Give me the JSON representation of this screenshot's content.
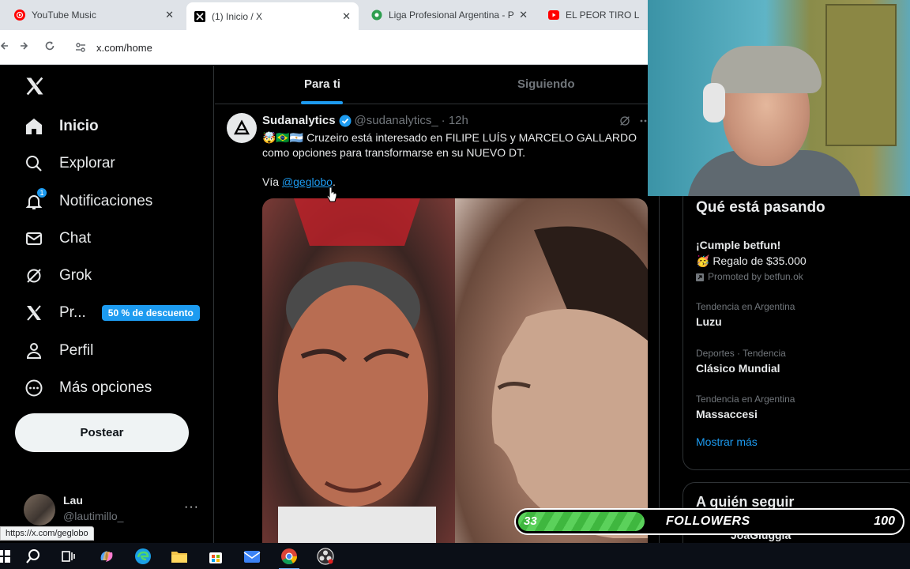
{
  "browser": {
    "tabs": [
      {
        "label": "YouTube Music",
        "icon": "youtube-music-icon",
        "active": false
      },
      {
        "label": "(1) Inicio / X",
        "icon": "x-logo-icon",
        "active": true
      },
      {
        "label": "Liga Profesional Argentina - PO",
        "icon": "ball-icon",
        "active": false
      },
      {
        "label": "EL PEOR TIRO LIBRE D",
        "icon": "youtube-icon",
        "active": false
      }
    ],
    "url": "x.com/home",
    "status_url": "https://x.com/geglobo"
  },
  "sidebar": {
    "items": [
      {
        "label": "Inicio",
        "icon": "home-icon"
      },
      {
        "label": "Explorar",
        "icon": "search-icon"
      },
      {
        "label": "Notificaciones",
        "icon": "bell-icon",
        "badge": "1"
      },
      {
        "label": "Chat",
        "icon": "mail-icon"
      },
      {
        "label": "Grok",
        "icon": "grok-icon"
      },
      {
        "label": "Pr...",
        "icon": "x-premium-icon",
        "promo": "50 % de descuento"
      },
      {
        "label": "Perfil",
        "icon": "person-icon"
      },
      {
        "label": "Más opciones",
        "icon": "more-circle-icon"
      }
    ],
    "post_button": "Postear",
    "account": {
      "name": "Lau",
      "handle": "@lautimillo_",
      "more": "···"
    }
  },
  "feed": {
    "tabs": [
      "Para ti",
      "Siguiendo"
    ],
    "post": {
      "author": "Sudanalytics",
      "handle": "@sudanalytics_",
      "time": "· 12h",
      "text": "🤯🇧🇷🇦🇷 Cruzeiro está interesado en FILIPE LUÍS y MARCELO GALLARDO como opciones para transformarse en su NUEVO DT.",
      "via_prefix": "Vía ",
      "via_link": "@geglobo",
      "via_suffix": "."
    }
  },
  "trends": {
    "title": "Qué está pasando",
    "items": [
      {
        "name": "¡Cumple betfun!",
        "sub": "🥳 Regalo de $35.000",
        "promo": "Promoted by betfun.ok"
      },
      {
        "meta": "Tendencia en Argentina",
        "name": "Luzu"
      },
      {
        "meta": "Deportes · Tendencia",
        "name": "Clásico Mundial"
      },
      {
        "meta": "Tendencia en Argentina",
        "name": "Massaccesi"
      }
    ],
    "show_more": "Mostrar más"
  },
  "who_to_follow": {
    "title": "A quién seguir",
    "user": "JoaGiuggia"
  },
  "followers_goal": {
    "current": 33,
    "label": "FOLLOWERS",
    "goal": 100,
    "current_text": "33",
    "goal_text": "100"
  },
  "colors": {
    "accent": "#1d9bf0",
    "background": "#000000",
    "text": "#e7e9ea",
    "muted": "#71767b",
    "progress_green": "#5bd15b"
  }
}
